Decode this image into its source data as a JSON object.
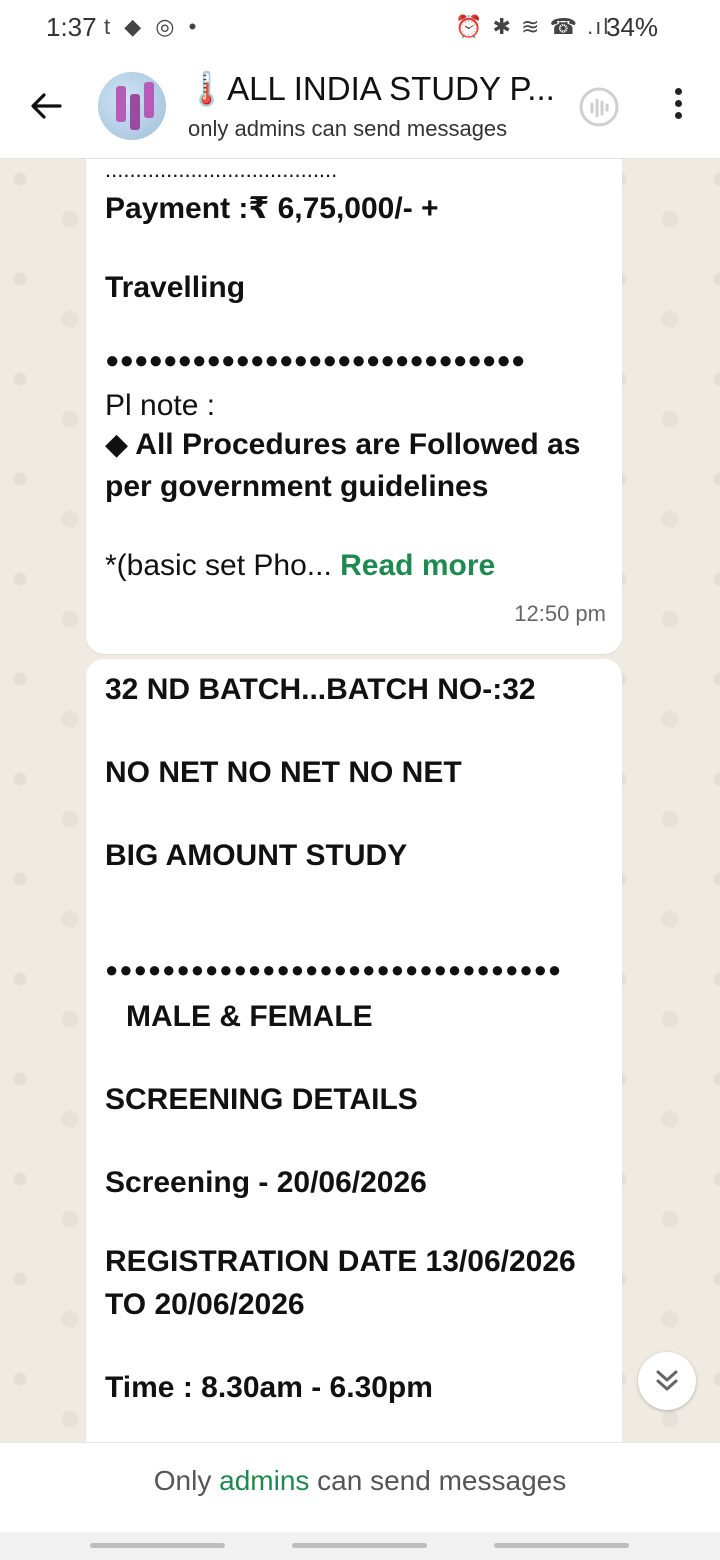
{
  "status_bar": {
    "time": "1:37",
    "left_icons": "t ◆ ◎ •",
    "right_icons": "⏰ ✱ ≋ ☎ .ıl",
    "battery": "34%"
  },
  "header": {
    "title": "🌡️ALL INDIA STUDY P...",
    "subtitle": "only admins can send messages"
  },
  "messages": [
    {
      "lines": [
        "......................................",
        "Payment :₹ 6,75,000/- +",
        " Travelling",
        " ●●●●●●●●●●●●●●●●●●●●●●●●●●●●●",
        "Pl note :",
        "◆ All Procedures are Followed as",
        "per government guidelines",
        "*(basic set Pho..."
      ],
      "read_more": "Read more",
      "time": "12:50 pm"
    },
    {
      "lines": [
        "32 ND BATCH...BATCH NO-:32",
        "NO NET NO NET NO NET",
        "BIG AMOUNT STUDY",
        "●●●●●●●●●●●●●●●●●●●●●●●●●●●●●●●●",
        "MALE & FEMALE",
        "SCREENING DETAILS",
        "Screening -  20/06/2026",
        "REGISTRATION DATE 13/06/2026",
        "TO 20/06/2026",
        "Time : 8.30am - 6.30pm"
      ]
    }
  ],
  "footer": {
    "prefix": "Only ",
    "accent": "admins",
    "suffix": " can send messages"
  },
  "colors": {
    "accent_green": "#1e8a4f",
    "chat_background": "#efeae2",
    "bubble": "#ffffff"
  }
}
